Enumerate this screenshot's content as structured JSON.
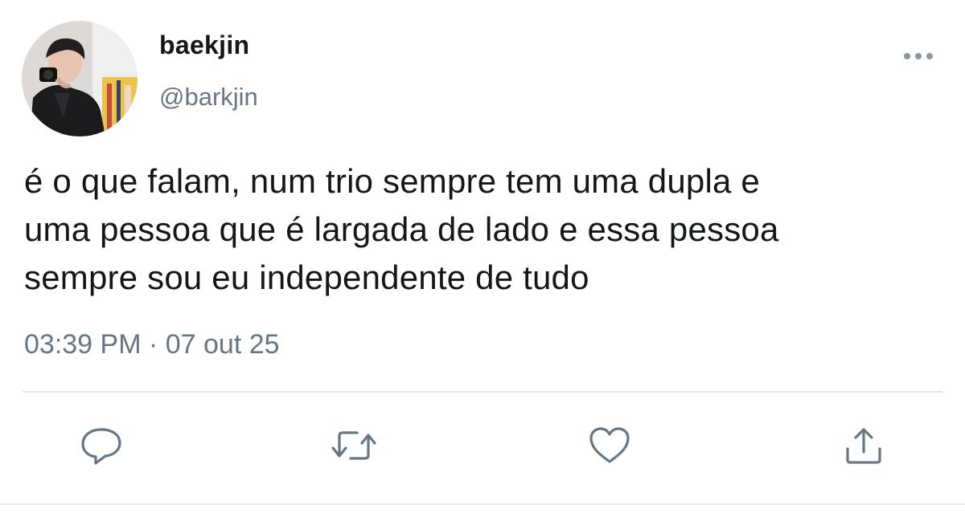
{
  "tweet": {
    "display_name": "baekjin",
    "handle": "@barkjin",
    "text_lines": [
      "é o que falam, num trio sempre tem uma dupla e",
      "uma pessoa que é largada de lado e essa pessoa",
      "sempre sou eu independente de tudo"
    ],
    "timestamp": "03:39 PM · 07 out 25"
  },
  "icons": {
    "more": "more-horizontal-icon",
    "reply": "reply-icon",
    "retweet": "retweet-icon",
    "like": "heart-icon",
    "share": "share-icon"
  },
  "colors": {
    "text": "#14171a",
    "secondary": "#657786",
    "action_icon": "#657786",
    "divider": "#e1e8ed"
  }
}
